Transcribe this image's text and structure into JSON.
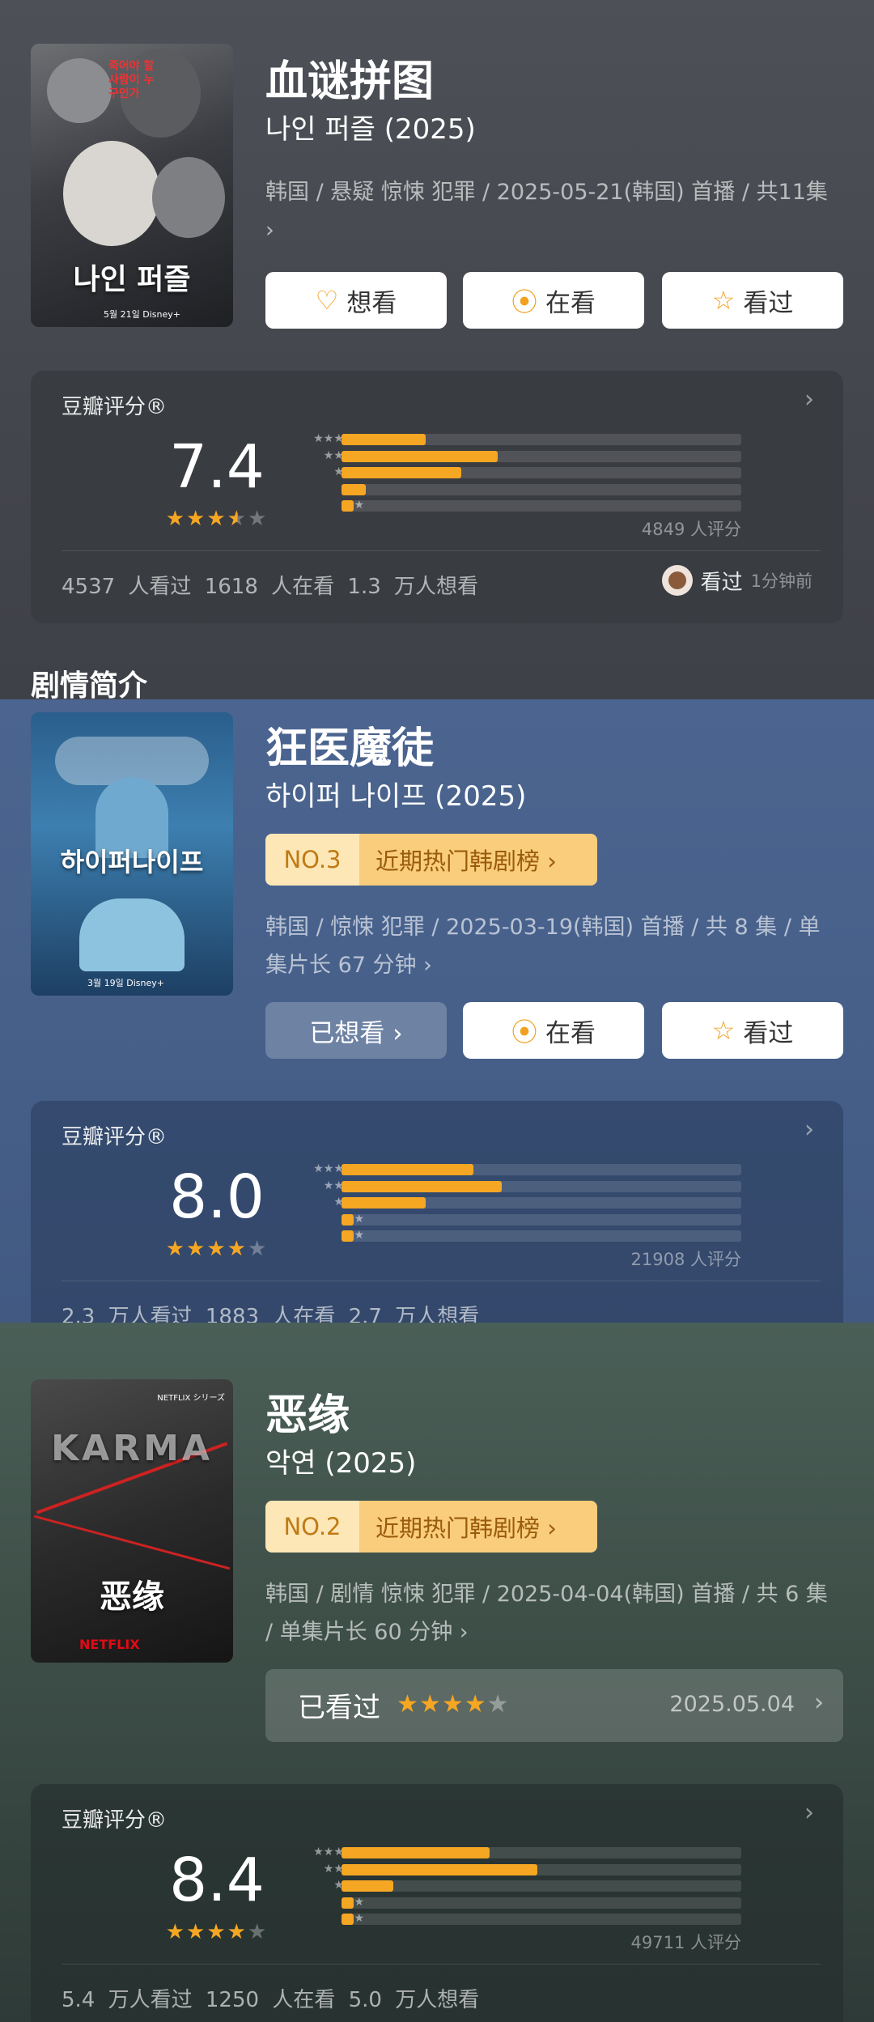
{
  "rating_label": "豆瓣评分®",
  "dist_star_rows": [
    "★★★★★",
    "★★★★",
    "★★★",
    "★★",
    "★"
  ],
  "colors": {
    "accent_star": "#f5a623",
    "rank_badge": "#f9cd7c"
  },
  "items": [
    {
      "title": "血谜拼图",
      "subtitle": "나인 퍼즐 (2025)",
      "meta": "韩国 / 悬疑 惊悚 犯罪 / 2025-05-21(韩国) 首播 / 共11集 ›",
      "poster": {
        "text": "나인 퍼즐",
        "tagline": "죽어야 할 사람이 누구인가",
        "small": "5월 21일 Disney+"
      },
      "buttons": [
        {
          "label": "想看",
          "icon": "heart-plus-icon"
        },
        {
          "label": "在看",
          "icon": "record-icon"
        },
        {
          "label": "看过",
          "icon": "star-outline-icon"
        }
      ],
      "rating": {
        "score": "7.4",
        "stars": [
          1,
          1,
          1,
          0.5,
          0
        ],
        "dist_pct": [
          21,
          39,
          30,
          6,
          3
        ],
        "count": "4849 人评分",
        "stats": [
          "4537 人看过",
          "1618 人在看",
          "1.3 万人想看"
        ],
        "friend": {
          "status": "看过",
          "time": "1分钟前"
        }
      }
    },
    {
      "title": "狂医魔徒",
      "subtitle": "하이퍼 나이프 (2025)",
      "rank": {
        "no": "NO.3",
        "label": "近期热门韩剧榜 ›"
      },
      "meta": "韩国 / 惊悚 犯罪 / 2025-03-19(韩国) 首播 / 共 8 集 / 单集片长 67 分钟 ›",
      "poster": {
        "text": "하이퍼나이프",
        "tagline": "",
        "small": "3월 19일 Disney+"
      },
      "buttons": [
        {
          "label": "已想看 ›",
          "icon": ""
        },
        {
          "label": "在看",
          "icon": "record-icon"
        },
        {
          "label": "看过",
          "icon": "star-outline-icon"
        }
      ],
      "rating": {
        "score": "8.0",
        "stars": [
          1,
          1,
          1,
          1,
          0
        ],
        "dist_pct": [
          33,
          40,
          21,
          3,
          3
        ],
        "count": "21908 人评分",
        "stats": [
          "2.3 万人看过",
          "1883 人在看",
          "2.7 万人想看"
        ]
      },
      "intro_heading": "剧情简介"
    },
    {
      "title": "恶缘",
      "subtitle": "악연 (2025)",
      "rank": {
        "no": "NO.2",
        "label": "近期热门韩剧榜 ›"
      },
      "meta": "韩国 / 剧情 惊悚 犯罪 / 2025-04-04(韩国) 首播 / 共 6 集 / 单集片长 60 分钟 ›",
      "poster": {
        "text": "恶缘",
        "tagline": "KARMA",
        "small": "NETFLIX シリーズ"
      },
      "watched": {
        "label": "已看过",
        "stars": [
          1,
          1,
          1,
          1,
          0
        ],
        "date": "2025.05.04"
      },
      "rating": {
        "score": "8.4",
        "stars": [
          1,
          1,
          1,
          1,
          0
        ],
        "dist_pct": [
          37,
          49,
          13,
          3,
          3
        ],
        "count": "49711 人评分",
        "stats": [
          "5.4 万人看过",
          "1250 人在看",
          "5.0 万人想看"
        ]
      }
    }
  ]
}
